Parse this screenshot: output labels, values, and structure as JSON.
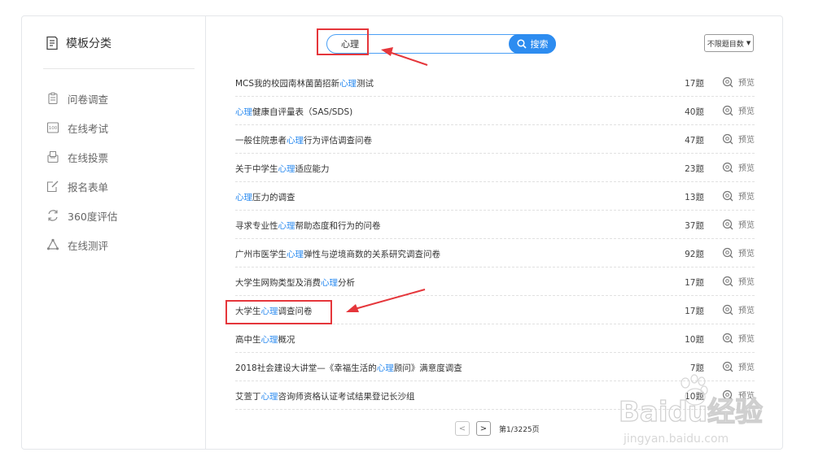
{
  "sidebar": {
    "header": "模板分类",
    "items": [
      {
        "label": "问卷调查",
        "icon": "clipboard-icon"
      },
      {
        "label": "在线考试",
        "icon": "score-icon"
      },
      {
        "label": "在线投票",
        "icon": "ballot-box-icon"
      },
      {
        "label": "报名表单",
        "icon": "edit-form-icon"
      },
      {
        "label": "360度评估",
        "icon": "refresh-icon"
      },
      {
        "label": "在线测评",
        "icon": "recycle-icon"
      }
    ]
  },
  "search": {
    "value": "心理",
    "button_label": "搜索"
  },
  "limit_select": {
    "selected": "不限题目数"
  },
  "keyword": "心理",
  "results": [
    {
      "before": "MCS我的校园南林菌菌招新",
      "kw": "心理",
      "after": "测试",
      "count": "17题",
      "preview": "预览"
    },
    {
      "before": "",
      "kw": "心理",
      "after": "健康自评量表（SAS/SDS)",
      "count": "40题",
      "preview": "预览"
    },
    {
      "before": "一般住院患者",
      "kw": "心理",
      "after": "行为评估调查问卷",
      "count": "47题",
      "preview": "预览"
    },
    {
      "before": "关于中学生",
      "kw": "心理",
      "after": "适应能力",
      "count": "23题",
      "preview": "预览"
    },
    {
      "before": "",
      "kw": "心理",
      "after": "压力的调查",
      "count": "13题",
      "preview": "预览"
    },
    {
      "before": "寻求专业性",
      "kw": "心理",
      "after": "帮助态度和行为的问卷",
      "count": "37题",
      "preview": "预览"
    },
    {
      "before": "广州市医学生",
      "kw": "心理",
      "after": "弹性与逆境商数的关系研究调查问卷",
      "count": "92题",
      "preview": "预览"
    },
    {
      "before": "大学生网购类型及消费",
      "kw": "心理",
      "after": "分析",
      "count": "17题",
      "preview": "预览"
    },
    {
      "before": "大学生",
      "kw": "心理",
      "after": "调查问卷",
      "count": "17题",
      "preview": "预览"
    },
    {
      "before": "高中生",
      "kw": "心理",
      "after": "概况",
      "count": "10题",
      "preview": "预览"
    },
    {
      "before": "2018社会建设大讲堂—《幸福生活的",
      "kw": "心理",
      "after": "顾问》满意度调查",
      "count": "7题",
      "preview": "预览"
    },
    {
      "before": "艾萱丁",
      "kw": "心理",
      "after": "咨询师资格认证考试结果登记长沙组",
      "count": "10题",
      "preview": "预览"
    }
  ],
  "pagination": {
    "prev": "<",
    "next": ">",
    "info": "第1/3225页"
  },
  "watermark": {
    "brand": "Baidu经验",
    "url": "jingyan.baidu.com"
  },
  "colors": {
    "accent": "#2d8cf0",
    "annotation": "#e5363b"
  }
}
